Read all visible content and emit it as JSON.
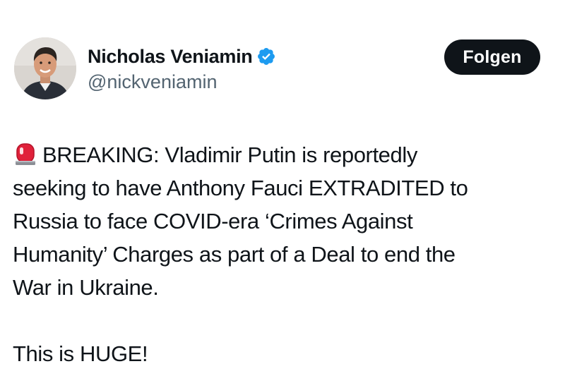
{
  "author": {
    "display_name": "Nicholas Veniamin",
    "handle": "@nickveniamin",
    "verified": true,
    "avatar_icon": "person-photo-avatar"
  },
  "follow_button": {
    "label": "Folgen"
  },
  "tweet": {
    "emoji_icon": "police-siren-icon",
    "lines": [
      "BREAKING: Vladimir Putin is reportedly",
      "seeking to have Anthony Fauci EXTRADITED to",
      "Russia to face COVID-era ‘Crimes Against",
      "Humanity’ Charges as part of a Deal to end the",
      "War in Ukraine."
    ],
    "closing": "This is HUGE!"
  },
  "colors": {
    "text": "#0f1419",
    "secondary_text": "#536471",
    "verified_badge": "#1d9bf0",
    "button_bg": "#0f1419",
    "button_text": "#ffffff"
  }
}
